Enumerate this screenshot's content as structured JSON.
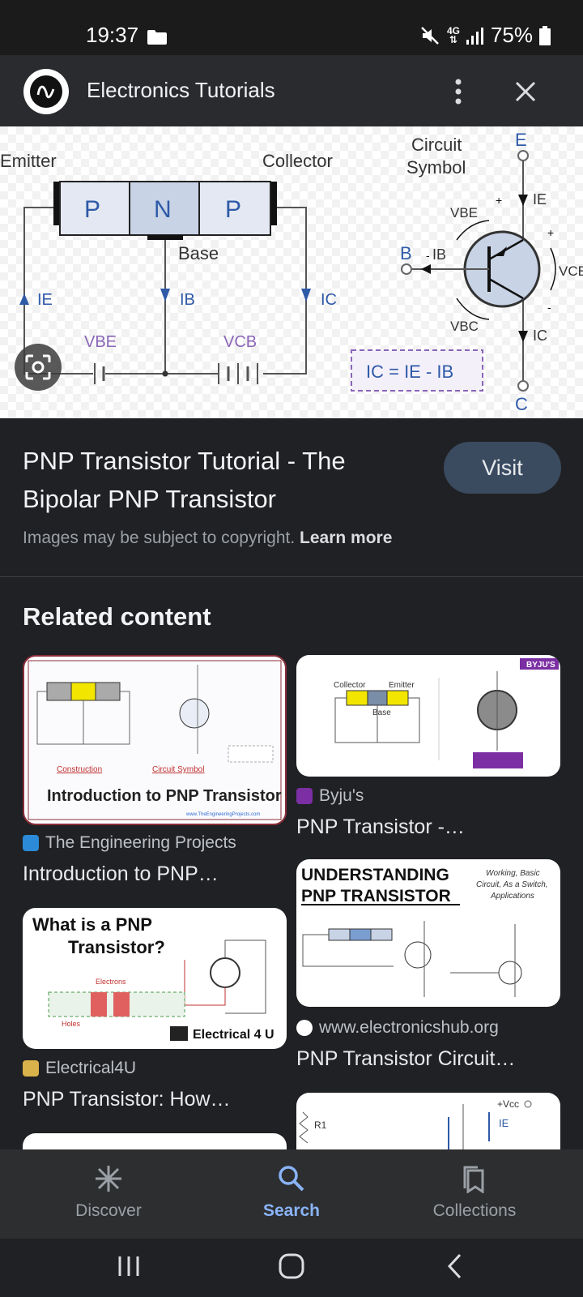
{
  "status": {
    "time": "19:37",
    "network": "4G",
    "battery": "75%"
  },
  "header": {
    "title": "Electronics Tutorials"
  },
  "hero": {
    "labels": {
      "emitter": "Emitter",
      "collector": "Collector",
      "base": "Base",
      "p1": "P",
      "n": "N",
      "p2": "P",
      "circuit_symbol_1": "Circuit",
      "circuit_symbol_2": "Symbol",
      "e": "E",
      "b": "B",
      "c": "C",
      "ie": "IE",
      "ib": "IB",
      "ic": "IC",
      "vbe": "VBE",
      "vcb": "VCB",
      "vbc": "VBC",
      "vce": "VCE",
      "formula": "IC = IE - IB"
    }
  },
  "result": {
    "title": "PNP Transistor Tutorial - The Bipolar PNP Transistor",
    "visit_label": "Visit",
    "copyright_text": "Images may be subject to copyright.",
    "learn_more": "Learn more"
  },
  "related": {
    "heading": "Related content",
    "items": [
      {
        "source": "The Engineering Projects",
        "title": "Introduction to PNP…",
        "image_caption": "Introduction to PNP Transistor",
        "image_labels": [
          "Construction",
          "Circuit Symbol",
          "www.TheEngineeringProjects.com"
        ]
      },
      {
        "source": "Byju's",
        "title": "PNP Transistor -…",
        "image_labels": [
          "Collector",
          "Emitter",
          "Base",
          "BYJU'S"
        ]
      },
      {
        "source": "www.electronicshub.org",
        "title": "PNP Transistor Circuit…",
        "image_caption": "UNDERSTANDING PNP TRANSISTOR",
        "image_subcaption": "Working, Basic Circuit, As a Switch, Applications"
      },
      {
        "source": "Electrical4U",
        "title": "PNP Transistor: How…",
        "image_caption": "What is a PNP Transistor?",
        "image_brand": "Electrical 4 U"
      }
    ]
  },
  "nav": {
    "discover": "Discover",
    "search": "Search",
    "collections": "Collections"
  },
  "colors": {
    "accent": "#8ab4f8",
    "background": "#202124",
    "visit_button": "#3a4a5f"
  }
}
